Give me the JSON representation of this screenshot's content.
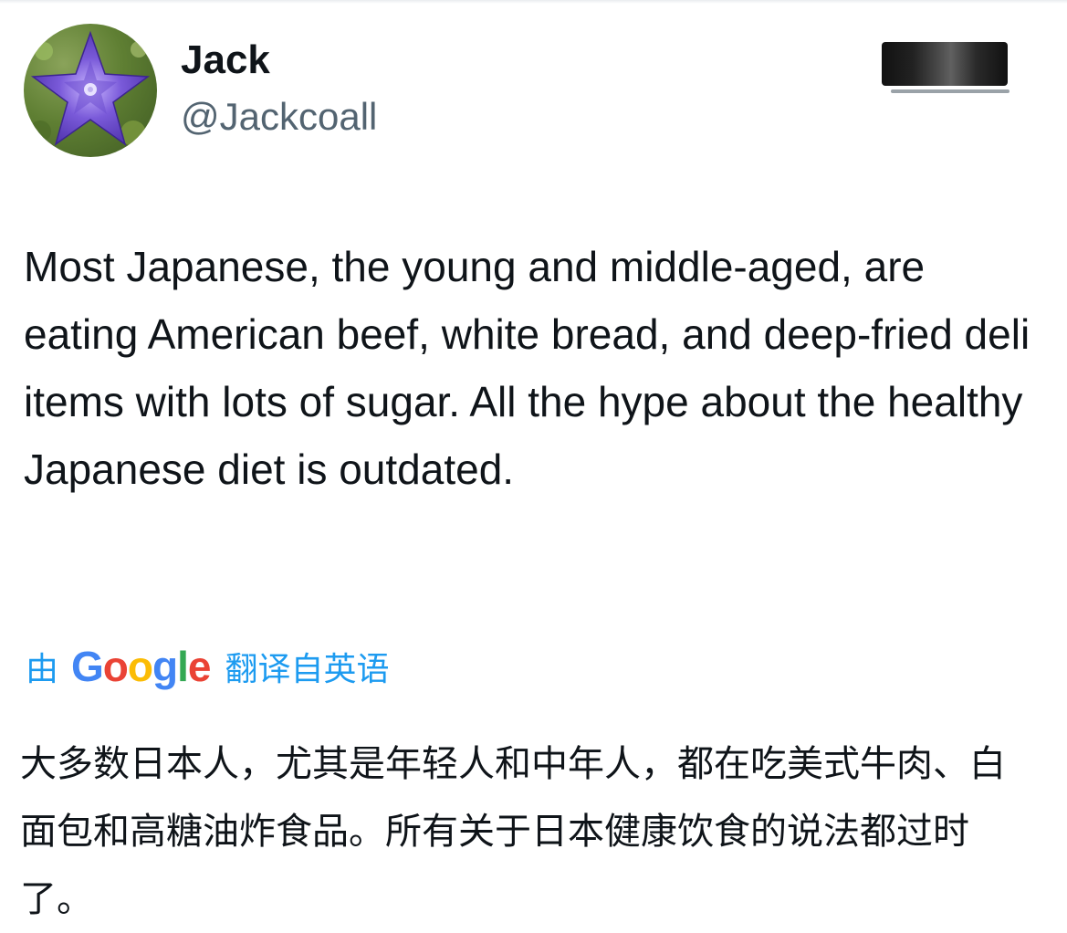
{
  "author": {
    "display_name": "Jack",
    "handle": "@Jackcoall",
    "avatar_icon": "purple-star-flower-avatar"
  },
  "tweet": {
    "text": "Most Japanese, the young and middle-aged, are eating American beef, white bread, and deep-fried deli items with lots of sugar. All the hype about the healthy Japanese diet is outdated."
  },
  "translation": {
    "prefix": "由",
    "logo_letters": [
      "G",
      "o",
      "o",
      "g",
      "l",
      "e"
    ],
    "suffix": "翻译自英语",
    "link_color": "#1d9bf0",
    "translated_text": "大多数日本人，尤其是年轻人和中年人，都在吃美式牛肉、白面包和高糖油炸食品。所有关于日本健康饮食的说法都过时了。"
  },
  "colors": {
    "text_primary": "#0f1419",
    "text_secondary": "#536471",
    "google_blue": "#4285f4",
    "google_red": "#ea4335",
    "google_yellow": "#fbbc05",
    "google_green": "#34a853"
  }
}
